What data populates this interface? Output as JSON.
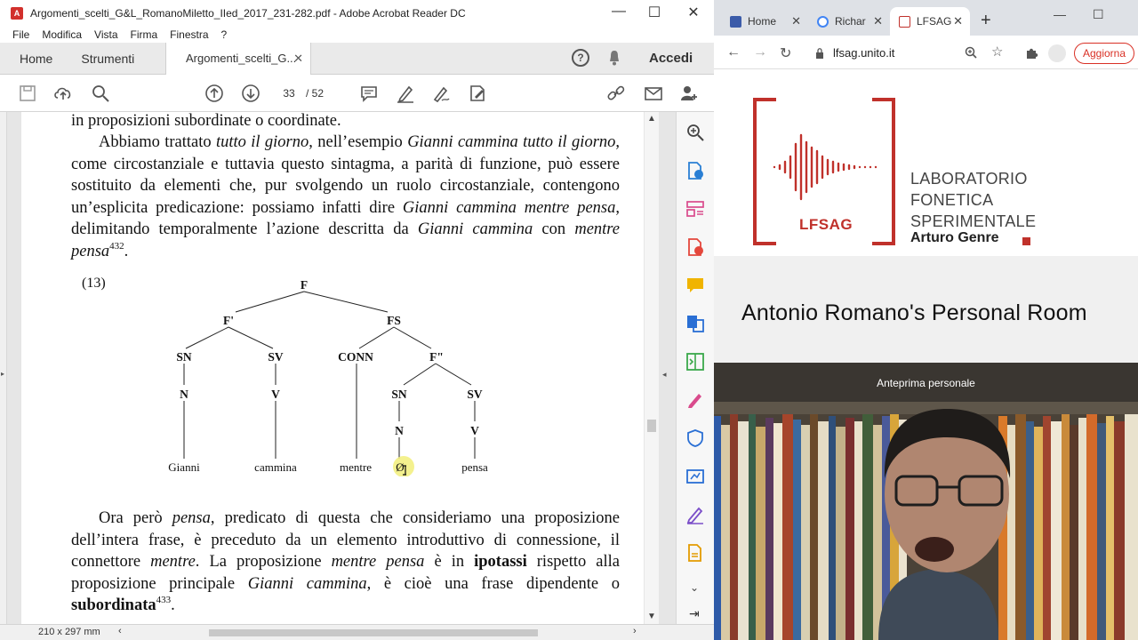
{
  "acrobat": {
    "title": "Argomenti_scelti_G&L_RomanoMiletto_IIed_2017_231-282.pdf - Adobe Acrobat Reader DC",
    "menu": [
      "File",
      "Modifica",
      "Vista",
      "Firma",
      "Finestra",
      "?"
    ],
    "tabs": {
      "home": "Home",
      "tools": "Strumenti",
      "document": "Argomenti_scelti_G...",
      "signin": "Accedi"
    },
    "toolbar": {
      "current_page": "33",
      "total_pages": "/ 52"
    },
    "status": {
      "page_size": "210 x 297 mm"
    }
  },
  "page": {
    "line_top": "in proposizioni subordinate o coordinate.",
    "example_number": "(13)",
    "tree_nodes": [
      "F",
      "F'",
      "FS",
      "SN",
      "SV",
      "CONN",
      "F\"",
      "N",
      "V",
      "SN",
      "SV",
      "N",
      "V"
    ],
    "tree_leaves": [
      "Gianni",
      "cammina",
      "mentre",
      "Ø",
      "pensa"
    ],
    "footnote_432": "432",
    "footnote_433": "433"
  },
  "chrome": {
    "tabs": [
      "Home",
      "Richar",
      "LFSAG"
    ],
    "url": "lfsag.unito.it",
    "update_button": "Aggiorna",
    "lab_name_lines": [
      "LABORATORIO",
      "FONETICA",
      "SPERIMENTALE"
    ],
    "lab_name_person": "Arturo Genre",
    "lab_logo_text": "LFSAG",
    "room_title": "Antonio Romano's Personal Room",
    "preview_label": "Anteprima personale"
  },
  "colors": {
    "lfsag_red": "#c0312b",
    "acrobat_red": "#d2302c",
    "chrome_update": "#d93025"
  }
}
